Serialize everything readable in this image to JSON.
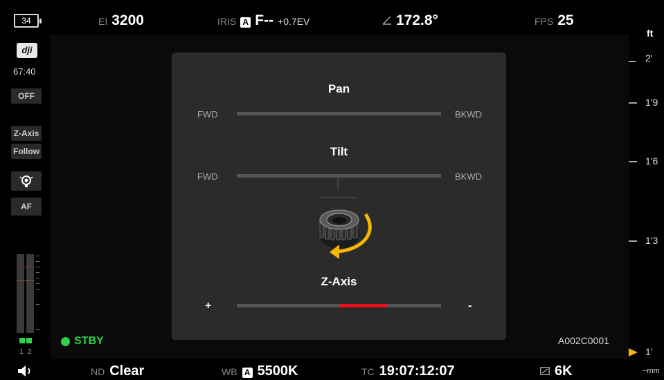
{
  "top": {
    "battery": "34",
    "ei_label": "EI",
    "ei_value": "3200",
    "iris_label": "IRIS",
    "iris_mode": "A",
    "iris_value": "F--",
    "iris_ev": "+0.7EV",
    "shutter_value": "172.8°",
    "fps_label": "FPS",
    "fps_value": "25"
  },
  "sidebar": {
    "logo": "dji",
    "timer": "67:40",
    "off_label": "OFF",
    "zaxis_label": "Z-Axis",
    "follow_label": "Follow",
    "af_label": "AF",
    "ch1": "1",
    "ch2": "2"
  },
  "scale": {
    "unit": "ft",
    "marks": [
      "2'",
      "1'9",
      "1'6",
      "1'3",
      "1'"
    ],
    "bottom_unit": "~mm"
  },
  "panel": {
    "pan_title": "Pan",
    "pan_left": "FWD",
    "pan_right": "BKWD",
    "tilt_title": "Tilt",
    "tilt_left": "FWD",
    "tilt_right": "BKWD",
    "zaxis_title": "Z-Axis",
    "zaxis_left": "+",
    "zaxis_right": "-",
    "zaxis_level": 0.24
  },
  "status": {
    "stby": "STBY",
    "clip": "A002C0001"
  },
  "bottom": {
    "nd_label": "ND",
    "nd_value": "Clear",
    "wb_label": "WB",
    "wb_mode": "A",
    "wb_value": "5500K",
    "tc_label": "TC",
    "tc_value": "19:07:12:07",
    "res_value": "6K"
  },
  "colors": {
    "accent_green": "#2dd34a",
    "accent_red": "#e4101b",
    "marker_yellow": "#f5b800"
  }
}
